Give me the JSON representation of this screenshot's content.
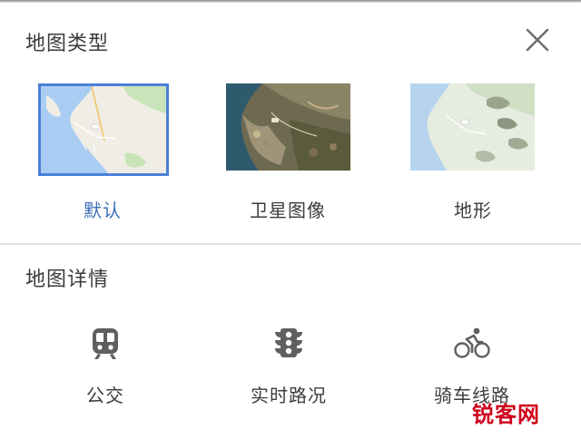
{
  "map_type": {
    "title": "地图类型",
    "options": [
      {
        "label": "默认",
        "selected": true
      },
      {
        "label": "卫星图像",
        "selected": false
      },
      {
        "label": "地形",
        "selected": false
      }
    ]
  },
  "map_details": {
    "title": "地图详情",
    "options": [
      {
        "label": "公交",
        "icon": "train-icon"
      },
      {
        "label": "实时路况",
        "icon": "traffic-light-icon"
      },
      {
        "label": "骑车线路",
        "icon": "bicycle-icon"
      }
    ]
  },
  "colors": {
    "accent": "#4a7fd6",
    "selected_label": "#3a6fb8",
    "text": "#3c3c3c",
    "icon": "#5f5f5f"
  },
  "watermark": {
    "text": "锐客网"
  }
}
